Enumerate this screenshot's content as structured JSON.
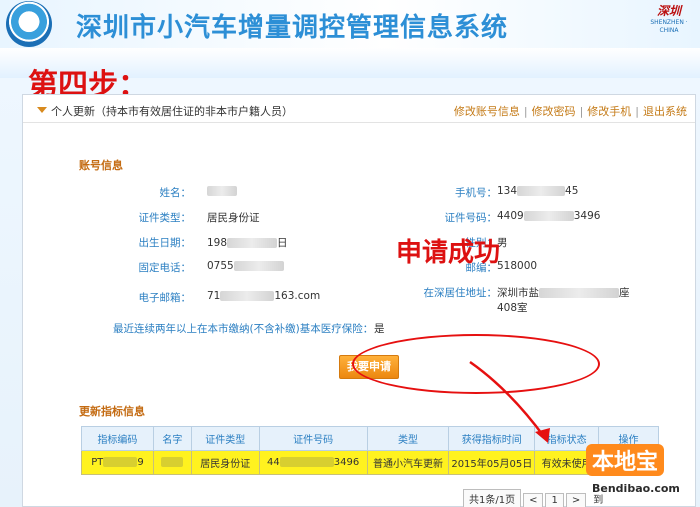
{
  "header": {
    "app_title": "深圳市小汽车增量调控管理信息系统",
    "city_mark_cn": "深圳",
    "city_mark_en": "SHENZHEN · CHINA"
  },
  "annotation": {
    "step": "第四步：",
    "success": "申请成功"
  },
  "page": {
    "title": "个人更新（持本市有效居住证的非本市户籍人员）",
    "links": [
      "修改账号信息",
      "修改密码",
      "修改手机",
      "退出系统"
    ]
  },
  "account": {
    "section_title": "账号信息",
    "fields": [
      {
        "label": "姓名：",
        "value": ""
      },
      {
        "label": "手机号：",
        "value": "134",
        "tail": "45"
      },
      {
        "label": "证件类型：",
        "value": "居民身份证"
      },
      {
        "label": "证件号码：",
        "value": "4409",
        "tail": "3496"
      },
      {
        "label": "出生日期：",
        "value": "198",
        "tail": "日"
      },
      {
        "label": "性别：",
        "value": "男"
      },
      {
        "label": "固定电话：",
        "value": "0755",
        "tail": ""
      },
      {
        "label": "邮编：",
        "value": "518000"
      },
      {
        "label": "电子邮箱：",
        "value": "71",
        "tail": "163.com"
      },
      {
        "label": "在深居住地址：",
        "value": "深圳市盐",
        "tail": "座",
        "line2": "408室"
      }
    ],
    "insurance_label": "最近连续两年以上在本市缴纳(不含补缴)基本医疗保险：",
    "insurance_value": "是"
  },
  "apply_button": "我要申请",
  "quota": {
    "section_title": "更新指标信息",
    "columns": [
      "指标编码",
      "名字",
      "证件类型",
      "证件号码",
      "类型",
      "获得指标时间",
      "指标状态",
      "操作"
    ],
    "rows": [
      {
        "code_prefix": "PT",
        "code_suffix": "9",
        "name": "",
        "id_type": "居民身份证",
        "id_prefix": "44",
        "id_suffix": "3496",
        "type": "普通小汽车更新",
        "date": "2015年05月05日",
        "status": "有效未使用",
        "action": ""
      }
    ]
  },
  "pager": {
    "summary": "共1条/1页",
    "prev": "<",
    "page": "1",
    "next": ">",
    "goto": "到"
  },
  "watermark": {
    "logo": "本地宝",
    "url": "Bendibao.com"
  },
  "colors": {
    "brand_blue": "#2d8fd6",
    "accent_orange": "#ec8710",
    "highlight_yellow": "#fff21f",
    "annotation_red": "#e61010"
  }
}
